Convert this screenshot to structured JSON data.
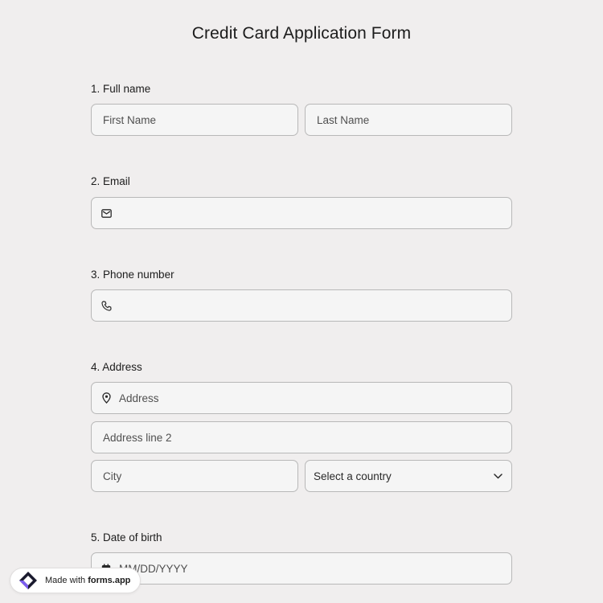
{
  "form": {
    "title": "Credit Card Application Form"
  },
  "questions": {
    "q1": {
      "label": "1.  Full name",
      "first_placeholder": "First Name",
      "last_placeholder": "Last Name"
    },
    "q2": {
      "label": "2. Email",
      "icon": "envelope-icon"
    },
    "q3": {
      "label": "3. Phone number",
      "icon": "phone-icon"
    },
    "q4": {
      "label": "4. Address",
      "address_placeholder": "Address",
      "address_icon": "map-pin-icon",
      "address2_placeholder": "Address line 2",
      "city_placeholder": "City",
      "country_select": "Select a country"
    },
    "q5": {
      "label": "5. Date of birth",
      "placeholder": "MM/DD/YYYY",
      "icon": "calendar-icon"
    }
  },
  "badge": {
    "prefix": "Made with ",
    "brand": "forms.app"
  },
  "colors": {
    "background": "#f0eeee",
    "field_background": "#f5f5f5",
    "field_border": "#b8b8b8",
    "logo_purple": "#7b5cf0",
    "logo_dark": "#1a1a2e"
  }
}
